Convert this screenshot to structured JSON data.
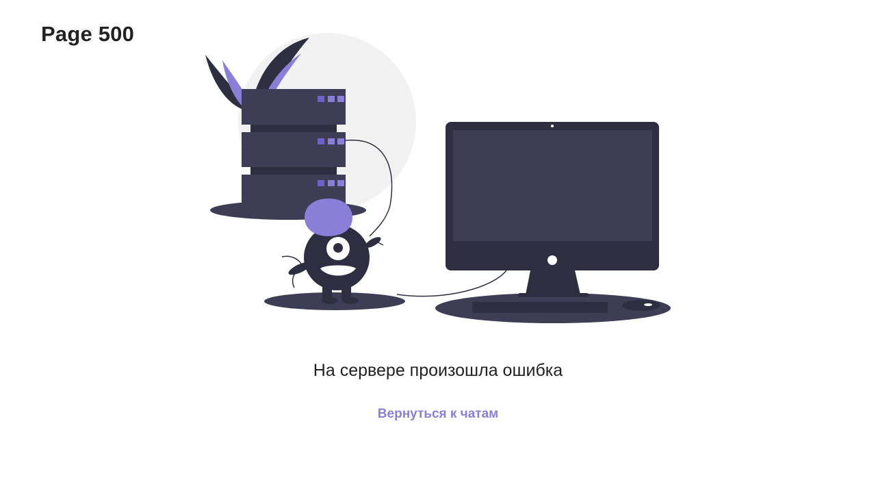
{
  "page": {
    "title": "Page 500",
    "message": "На сервере произошла ошибка",
    "back_link": "Вернуться к чатам"
  },
  "illustration": {
    "icons": [
      "server-icon",
      "monster-icon",
      "monitor-icon",
      "plant-icon",
      "mouse-icon",
      "keyboard-icon"
    ],
    "colors": {
      "dark": "#2f2e41",
      "panel": "#3f3d56",
      "accent": "#8a7ed9",
      "light_circle": "#f2f2f2"
    }
  }
}
